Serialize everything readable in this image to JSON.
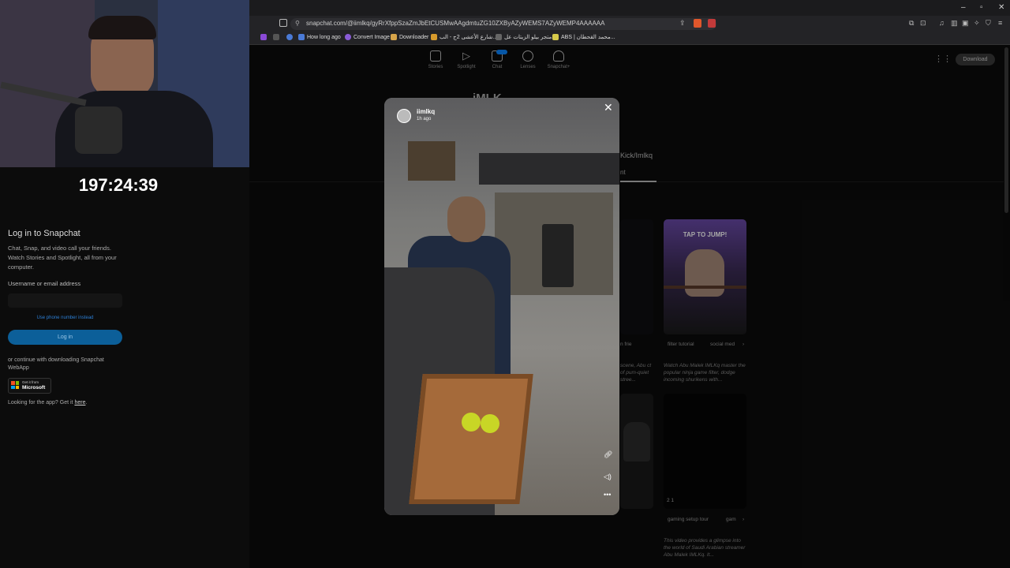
{
  "browser": {
    "url": "snapchat.com/@iimlkq/gyRrXfppSzaZmJbEtCUSMwAAgdmtuZG10ZXByAZyWEMS7AZyWEMP4AAAAAA",
    "bookmarks": [
      {
        "label": "How long ago",
        "color": "#4a7ad6"
      },
      {
        "label": "Convert Image",
        "color": "#8a5cd6"
      },
      {
        "label": "Downloader",
        "color": "#d6a44a"
      },
      {
        "label": "شارع الأعشى 2ج - الب...",
        "color": "#d69a2c"
      },
      {
        "label": "متجر بيلو الزيتات عل...",
        "color": "#666666"
      },
      {
        "label": "ABS | محمد القحطان...",
        "color": "#d6c94a"
      }
    ]
  },
  "snapchat_nav": [
    {
      "label": "Stories",
      "icon": "stories-icon"
    },
    {
      "label": "Spotlight",
      "icon": "play-icon"
    },
    {
      "label": "Chat",
      "icon": "chat-icon"
    },
    {
      "label": "Lenses",
      "icon": "lens-icon"
    },
    {
      "label": "Snapchat+",
      "icon": "ghost-icon"
    }
  ],
  "download_label": "Download",
  "stream": {
    "timer": "197:24:39"
  },
  "login": {
    "title": "Log in to Snapchat",
    "subtitle": "Chat, Snap, and video call your friends. Watch Stories and Spotlight, all from your computer.",
    "username_label": "Username or email address",
    "phone_link": "Use phone number instead",
    "login_button": "Log in",
    "continue_text": "or continue with downloading Snapchat WebApp",
    "ms_line1": "Get it from",
    "ms_line2": "Microsoft",
    "app_text_prefix": "Looking for the app? Get it ",
    "app_link": "here"
  },
  "profile_bg": {
    "handle": "iMLK",
    "kick_text": "Kick/Imlkq",
    "tab_fragment": "nt",
    "cards": [
      {
        "tags": [
          "filter tutorial",
          "social med"
        ],
        "thumb_text": "TAP TO JUMP!",
        "description": "Watch Abu Malek IMLKq master the popular ninja game filter, dodge incoming shurikens with..."
      },
      {
        "tags": [
          "gaming setup tour",
          "gam"
        ],
        "stats": "2  1",
        "description": "This video provides a glimpse into the world of Saudi Arabian streamer Abu Malek IMLKq. It..."
      }
    ],
    "left_card_fragments": {
      "tags": "n  frie",
      "description": "scene, Abu ct of pum-quiet stree..."
    }
  },
  "story": {
    "username": "iimlkq",
    "time": "1h ago"
  }
}
